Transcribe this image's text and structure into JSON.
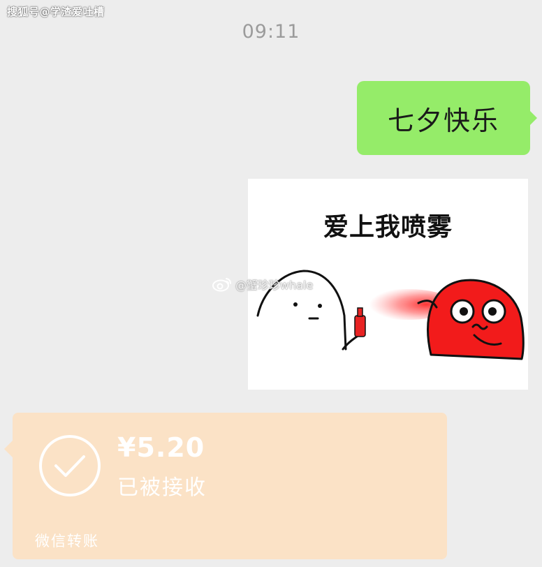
{
  "watermark": {
    "source": "搜狐号@学渣爱吐槽",
    "weibo": "@蟹珍珍whale"
  },
  "chat": {
    "time": "09:11",
    "sent_text": "七夕快乐",
    "sticker": {
      "caption": "爱上我喷雾"
    },
    "transfer": {
      "amount": "¥5.20",
      "status": "已被接收",
      "label": "微信转账",
      "status_icon": "check-circle-icon"
    }
  },
  "colors": {
    "background": "#ededed",
    "sent_bubble": "#95ec69",
    "transfer_card": "#fbe2c6",
    "timestamp": "#9b9b9b"
  }
}
